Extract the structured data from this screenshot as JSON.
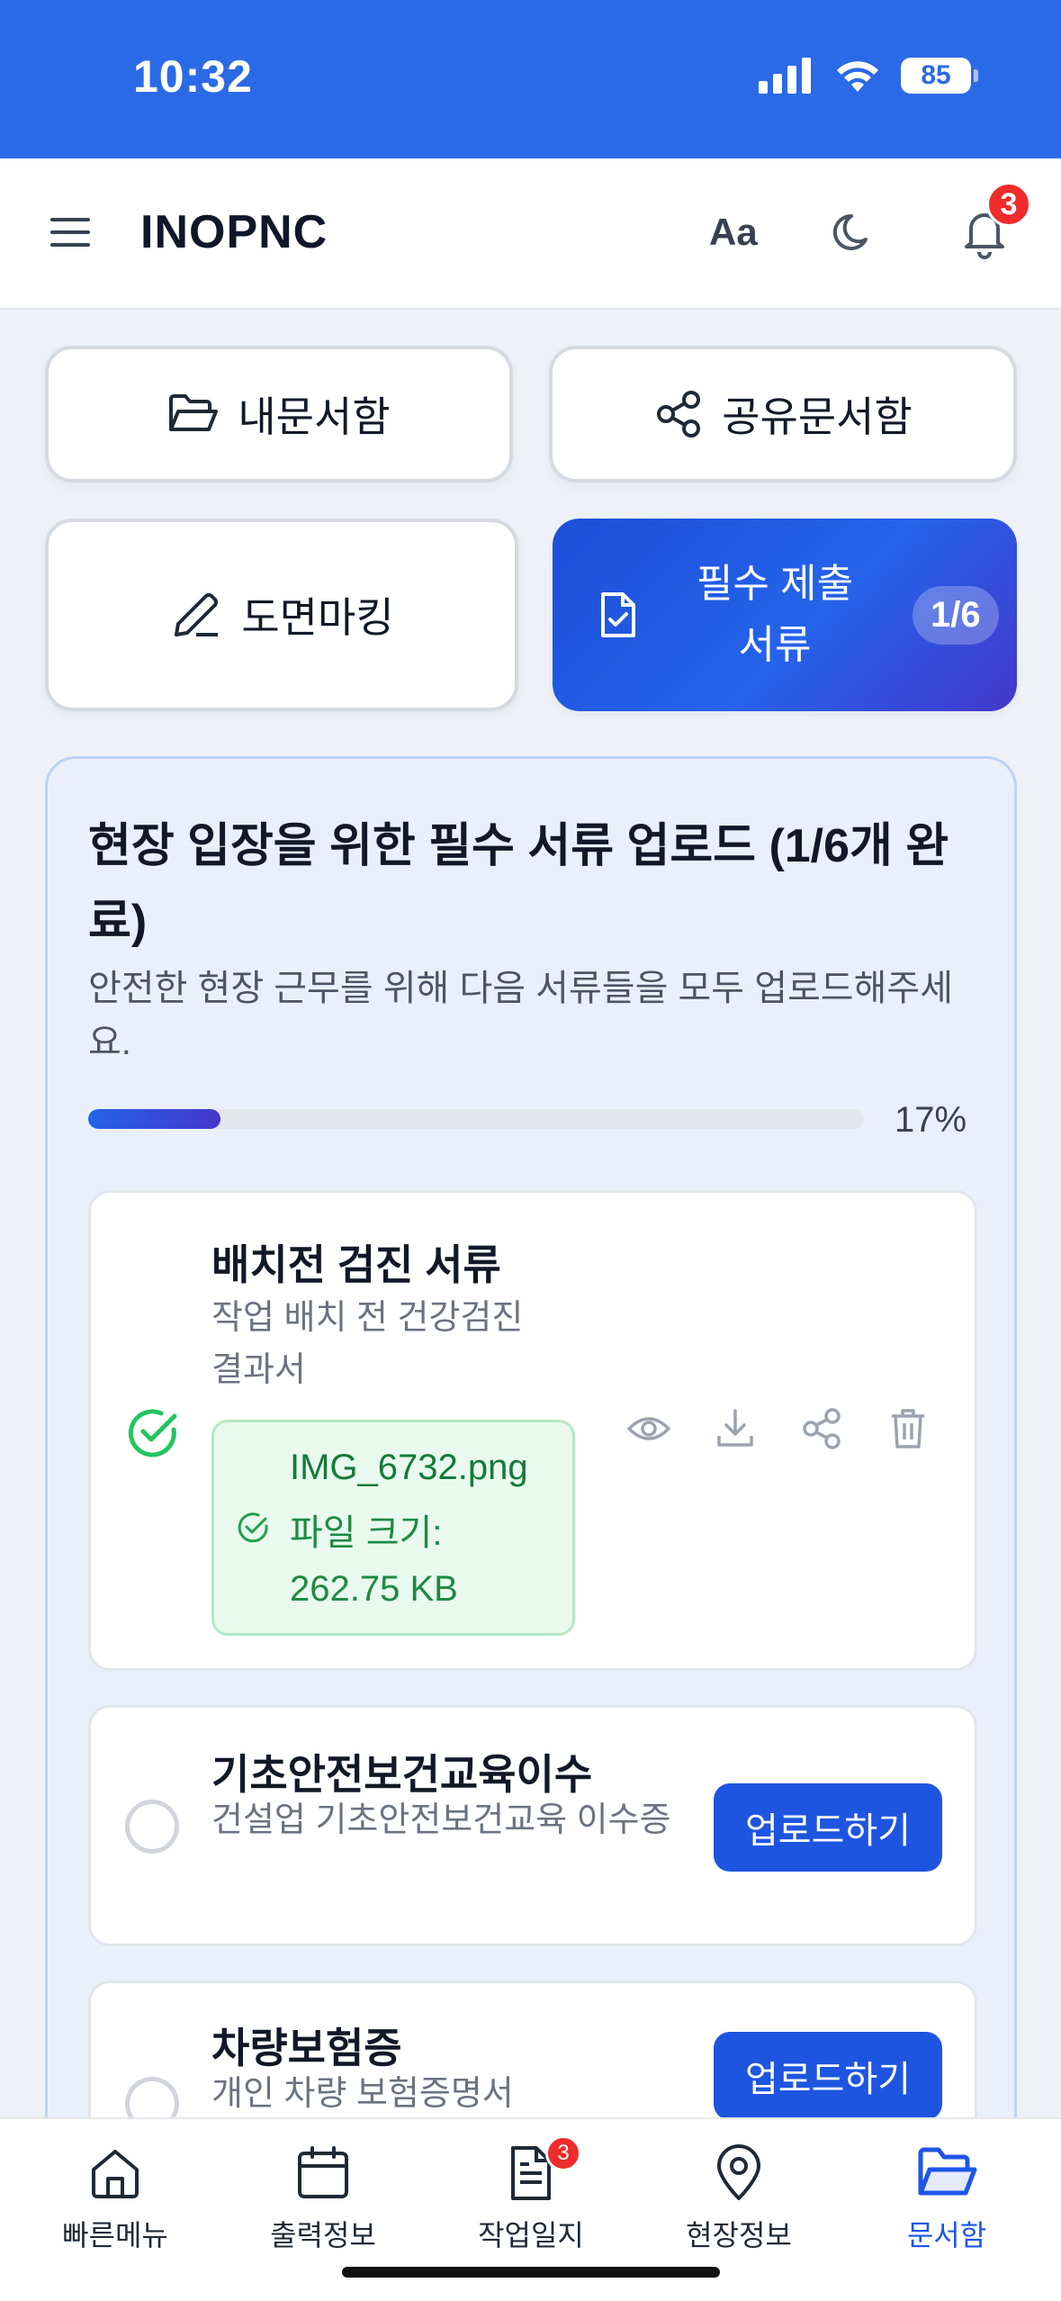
{
  "status": {
    "time": "10:32",
    "battery": "85"
  },
  "header": {
    "app_title": "INOPNC",
    "font_label": "Aa",
    "notification_count": "3"
  },
  "tiles": {
    "my_docs": "내문서함",
    "shared_docs": "공유문서함",
    "drawing": "도면마킹",
    "required": "필수 제출 서류",
    "required_count": "1/6"
  },
  "panel": {
    "title": "현장 입장을 위한 필수 서류 업로드 (1/6개 완료)",
    "description": "안전한 현장 근무를 위해 다음 서류들을 모두 업로드해주세요.",
    "progress_label": "17%",
    "progress_fraction": 0.17
  },
  "documents": [
    {
      "title": "배치전 검진 서류",
      "subtitle": "작업 배치 전 건강검진 결과서",
      "status": "completed",
      "file_name": "IMG_6732.png",
      "file_size": "파일 크기: 262.75 KB"
    },
    {
      "title": "기초안전보건교육이수",
      "subtitle": "건설업 기초안전보건교육 이수증",
      "status": "pending",
      "button": "업로드하기"
    },
    {
      "title": "차량보험증",
      "subtitle": "개인 차량 보험증명서",
      "status": "pending",
      "button": "업로드하기"
    }
  ],
  "tabbar": [
    {
      "label": "빠른메뉴",
      "icon": "home-icon"
    },
    {
      "label": "출력정보",
      "icon": "calendar-icon"
    },
    {
      "label": "작업일지",
      "icon": "document-icon",
      "badge": "3"
    },
    {
      "label": "현장정보",
      "icon": "map-pin-icon"
    },
    {
      "label": "문서함",
      "icon": "folder-open-icon",
      "active": true
    }
  ],
  "colors": {
    "primary": "#1e55e0",
    "success": "#22c55e",
    "badge": "#ef2b2b",
    "status_bar": "#2b6ae6"
  }
}
